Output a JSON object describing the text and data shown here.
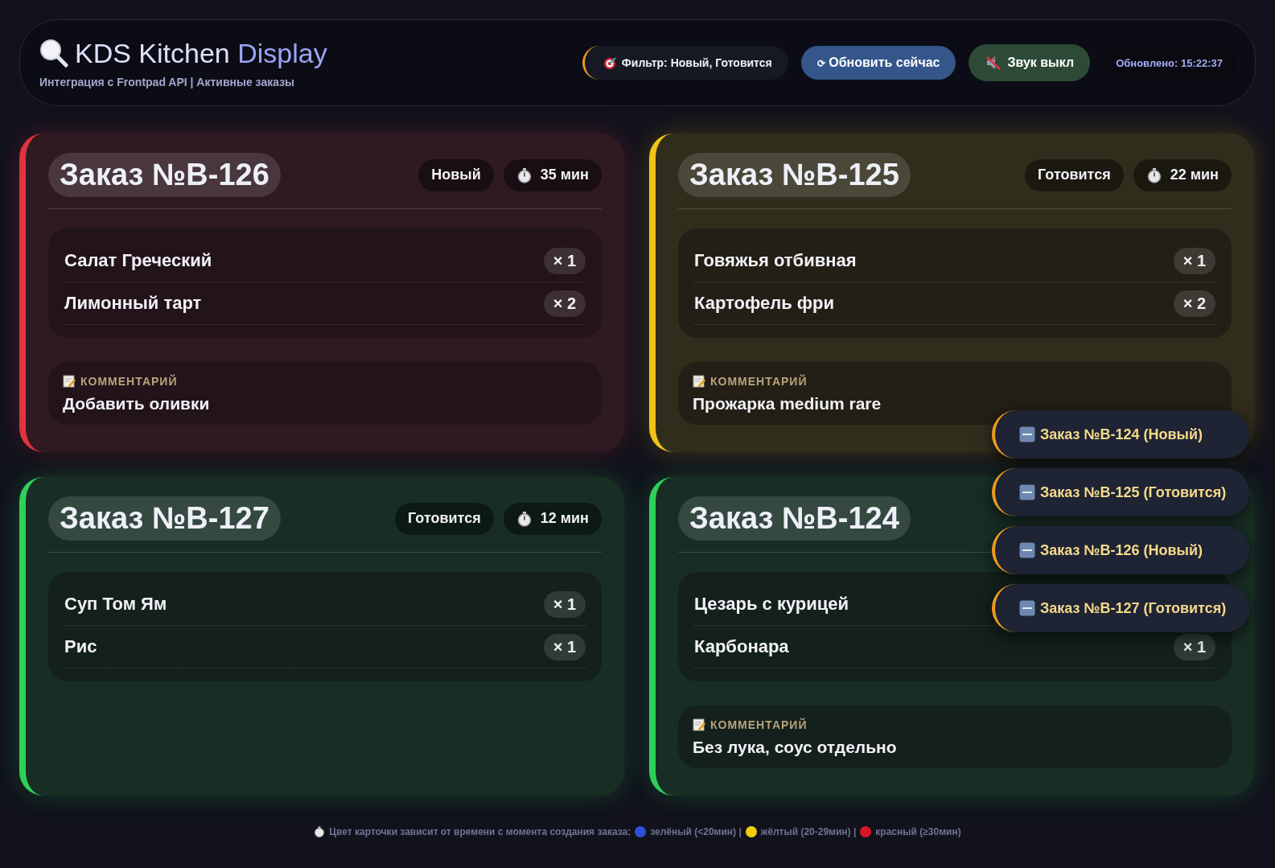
{
  "header": {
    "title_plain": "KDS Kitchen",
    "title_accent": "Display",
    "subtitle": "Интеграция с Frontpad API | Активные заказы",
    "filter": "Фильтр: Новый, Готовится",
    "refresh_glyph": "⟳",
    "refresh": "Обновить сейчас",
    "sound": "Звук выкл",
    "sound_on": false,
    "updated": "Обновлено: 15:22:37"
  },
  "orders": [
    {
      "title": "Заказ №B-126",
      "color": "#e0343e",
      "status": "Новый",
      "time": "35 мин",
      "items": [
        {
          "name": "Салат Греческий",
          "qty": "× 1"
        },
        {
          "name": "Лимонный тарт",
          "qty": "× 2"
        }
      ],
      "comment_label": "КОММЕНТАРИЙ",
      "comment": "Добавить оливки"
    },
    {
      "title": "Заказ №B-125",
      "color": "#f0c419",
      "status": "Готовится",
      "time": "22 мин",
      "items": [
        {
          "name": "Говяжья отбивная",
          "qty": "× 1"
        },
        {
          "name": "Картофель фри",
          "qty": "× 2"
        }
      ],
      "comment_label": "КОММЕНТАРИЙ",
      "comment": "Прожарка medium rare"
    },
    {
      "title": "Заказ №B-127",
      "color": "#2fd05a",
      "status": "Готовится",
      "time": "12 мин",
      "items": [
        {
          "name": "Суп Том Ям",
          "qty": "× 1"
        },
        {
          "name": "Рис",
          "qty": "× 1"
        }
      ]
    },
    {
      "title": "Заказ №B-124",
      "color": "#2fd05a",
      "items": [
        {
          "name": "Цезарь с курицей"
        },
        {
          "name": "Карбонара",
          "qty": "× 1"
        }
      ],
      "comment_label": "КОММЕНТАРИЙ",
      "comment": "Без лука, соус отдельно"
    }
  ],
  "toasts": [
    "Заказ №B-124 (Новый)",
    "Заказ №B-125 (Готовится)",
    "Заказ №B-126 (Новый)",
    "Заказ №B-127 (Готовится)"
  ],
  "footer": [
    {
      "kind": "text",
      "text": "Цвет карточки зависит от времени с момента создания заказа:"
    },
    {
      "kind": "dot",
      "color": "#2f4fd8"
    },
    {
      "kind": "text",
      "text": "зелёный (<20мин) |"
    },
    {
      "kind": "dot",
      "color": "#f2cc0c"
    },
    {
      "kind": "text",
      "text": "жёлтый (20-29мин) |"
    },
    {
      "kind": "dot",
      "color": "#d8182a"
    },
    {
      "kind": "text",
      "text": "красный (≥30мин)"
    }
  ]
}
